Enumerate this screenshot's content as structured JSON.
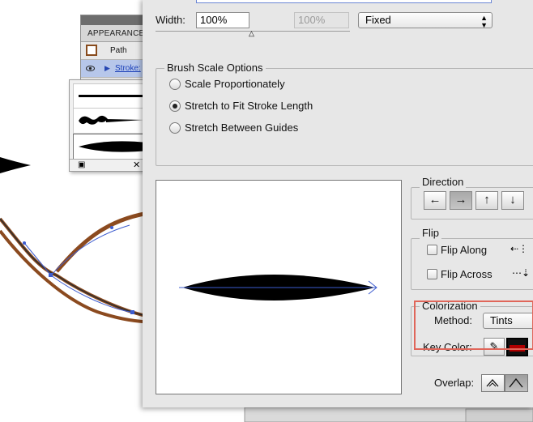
{
  "appearance_panel": {
    "tab": "APPEARANCE",
    "rows": [
      {
        "label": "Path"
      },
      {
        "label": "Stroke:"
      }
    ]
  },
  "dialog": {
    "width_label": "Width:",
    "width_value": "100%",
    "width_max_value": "100%",
    "width_mode": "Fixed",
    "brush_scale": {
      "title": "Brush Scale Options",
      "options": [
        {
          "label": "Scale Proportionately",
          "selected": false
        },
        {
          "label": "Stretch to Fit Stroke Length",
          "selected": true
        },
        {
          "label": "Stretch Between Guides",
          "selected": false
        }
      ]
    },
    "direction": {
      "title": "Direction",
      "buttons": [
        "←",
        "→",
        "↑",
        "↓"
      ],
      "selected_index": 1
    },
    "flip": {
      "title": "Flip",
      "along_label": "Flip Along",
      "across_label": "Flip Across"
    },
    "colorization": {
      "title": "Colorization",
      "method_label": "Method:",
      "method_value": "Tints",
      "key_color_label": "Key Color:"
    },
    "overlap_label": "Overlap:"
  },
  "colors": {
    "dialog_bg": "#e7e7e7",
    "highlight": "#e0665a",
    "selection_blue": "#3d5ccf",
    "path_brown": "#8b4a1f"
  }
}
